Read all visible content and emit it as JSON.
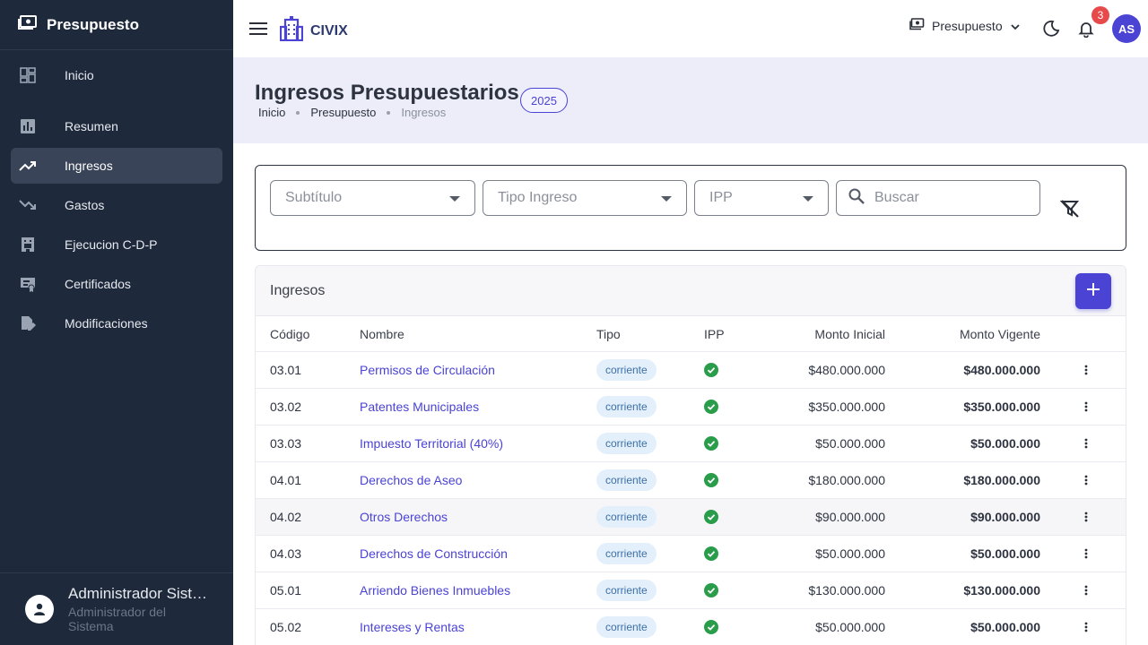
{
  "sidebar": {
    "title": "Presupuesto",
    "items": [
      {
        "label": "Inicio"
      },
      {
        "label": "Resumen"
      },
      {
        "label": "Ingresos"
      },
      {
        "label": "Gastos"
      },
      {
        "label": "Ejecucion C-D-P"
      },
      {
        "label": "Certificados"
      },
      {
        "label": "Modificaciones"
      }
    ],
    "user": {
      "name": "Administrador Sistema",
      "role": "Administrador del Sistema"
    }
  },
  "topbar": {
    "brand": "CIVIX",
    "module": "Presupuesto",
    "notifications_count": "3",
    "user_initials": "AS"
  },
  "header": {
    "title": "Ingresos Presupuestarios",
    "year": "2025",
    "breadcrumb": [
      "Inicio",
      "Presupuesto",
      "Ingresos"
    ]
  },
  "filters": {
    "subtitulo_placeholder": "Subtítulo",
    "tipo_placeholder": "Tipo Ingreso",
    "ipp_placeholder": "IPP",
    "search_placeholder": "Buscar"
  },
  "table": {
    "title": "Ingresos",
    "columns": [
      "Código",
      "Nombre",
      "Tipo",
      "IPP",
      "Monto Inicial",
      "Monto Vigente"
    ],
    "rows": [
      {
        "code": "03.01",
        "name": "Permisos de Circulación",
        "tipo": "corriente",
        "inicial": "$480.000.000",
        "vigente": "$480.000.000"
      },
      {
        "code": "03.02",
        "name": "Patentes Municipales",
        "tipo": "corriente",
        "inicial": "$350.000.000",
        "vigente": "$350.000.000"
      },
      {
        "code": "03.03",
        "name": "Impuesto Territorial (40%)",
        "tipo": "corriente",
        "inicial": "$50.000.000",
        "vigente": "$50.000.000"
      },
      {
        "code": "04.01",
        "name": "Derechos de Aseo",
        "tipo": "corriente",
        "inicial": "$180.000.000",
        "vigente": "$180.000.000"
      },
      {
        "code": "04.02",
        "name": "Otros Derechos",
        "tipo": "corriente",
        "inicial": "$90.000.000",
        "vigente": "$90.000.000"
      },
      {
        "code": "04.03",
        "name": "Derechos de Construcción",
        "tipo": "corriente",
        "inicial": "$50.000.000",
        "vigente": "$50.000.000"
      },
      {
        "code": "05.01",
        "name": "Arriendo Bienes Inmuebles",
        "tipo": "corriente",
        "inicial": "$130.000.000",
        "vigente": "$130.000.000"
      },
      {
        "code": "05.02",
        "name": "Intereses y Rentas",
        "tipo": "corriente",
        "inicial": "$50.000.000",
        "vigente": "$50.000.000"
      }
    ]
  },
  "colors": {
    "accent": "#4a43d4",
    "sidebar_bg": "#1e2a3b",
    "check": "#2a9d4b",
    "badge": "#e64a4a"
  }
}
